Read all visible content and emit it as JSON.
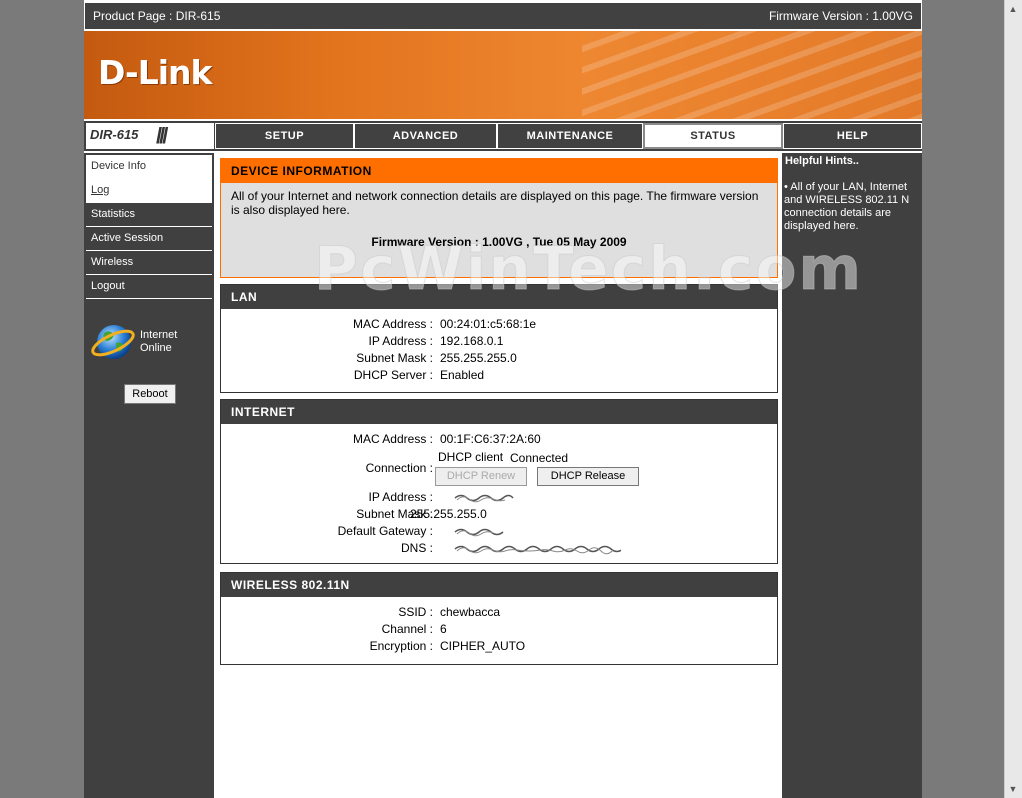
{
  "topbar": {
    "product": "Product Page :  DIR-615",
    "firmware": "Firmware Version : 1.00VG"
  },
  "brand": {
    "logo": "D-Link"
  },
  "model": {
    "name": "DIR-615",
    "slashes": "///"
  },
  "tabs": [
    {
      "label": "SETUP"
    },
    {
      "label": "ADVANCED"
    },
    {
      "label": "MAINTENANCE"
    },
    {
      "label": "STATUS",
      "active": true
    },
    {
      "label": "HELP"
    }
  ],
  "sidebar": {
    "items": [
      {
        "label": "Device Info"
      },
      {
        "label": "Log"
      },
      {
        "label": "Statistics"
      },
      {
        "label": "Active Session"
      },
      {
        "label": "Wireless"
      },
      {
        "label": "Logout"
      }
    ],
    "status_line1": "Internet",
    "status_line2": "Online",
    "reboot": "Reboot"
  },
  "device_info": {
    "title": "DEVICE INFORMATION",
    "description": "All of your Internet and network connection details are displayed on this page. The firmware version is also displayed here.",
    "firmware": "Firmware Version : 1.00VG ,  Tue 05 May 2009"
  },
  "lan": {
    "title": "LAN",
    "rows": [
      {
        "label": "MAC Address :",
        "value": "00:24:01:c5:68:1e"
      },
      {
        "label": "IP Address :",
        "value": "192.168.0.1"
      },
      {
        "label": "Subnet Mask :",
        "value": "255.255.255.0"
      },
      {
        "label": "DHCP Server :",
        "value": "Enabled"
      }
    ]
  },
  "internet": {
    "title": "INTERNET",
    "mac_label": "MAC Address :",
    "mac_value": "00:1F:C6:37:2A:60",
    "connection_label": "Connection :",
    "connection_type": "DHCP client",
    "connection_status": "Connected",
    "renew_label": "DHCP Renew",
    "release_label": "DHCP Release",
    "ip_label": "IP Address :",
    "subnet_label": "Subnet Mask :",
    "subnet_value": "255.255.255.0",
    "gateway_label": "Default Gateway :",
    "dns_label": "DNS :"
  },
  "wireless": {
    "title": "WIRELESS 802.11N",
    "rows": [
      {
        "label": "SSID :",
        "value": "chewbacca"
      },
      {
        "label": "Channel :",
        "value": "6"
      },
      {
        "label": "Encryption :",
        "value": "CIPHER_AUTO"
      }
    ]
  },
  "help": {
    "title": "Helpful Hints..",
    "text": "•  All of your LAN, Internet and WIRELESS 802.11 N connection details are displayed here."
  },
  "watermark": "PcWinTech.com",
  "colors": {
    "accent": "#ff6f00",
    "dark": "#404040",
    "banner": "#e2741d"
  }
}
